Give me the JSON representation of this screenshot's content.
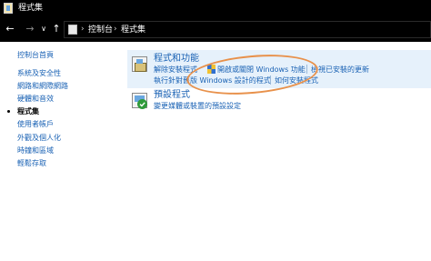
{
  "window": {
    "title": "程式集"
  },
  "nav": {
    "back": "←",
    "forward": "→",
    "recent": "∨",
    "up": "↑",
    "breadcrumb": [
      "控制台",
      "程式集"
    ],
    "separator": "›"
  },
  "sidebar": {
    "items": [
      {
        "label": "控制台首頁",
        "current": false
      },
      {
        "label": "系統及安全性",
        "current": false
      },
      {
        "label": "網路和網際網路",
        "current": false
      },
      {
        "label": "硬體和音效",
        "current": false
      },
      {
        "label": "程式集",
        "current": true
      },
      {
        "label": "使用者帳戶",
        "current": false
      },
      {
        "label": "外觀及個人化",
        "current": false
      },
      {
        "label": "時鐘和區域",
        "current": false
      },
      {
        "label": "輕鬆存取",
        "current": false
      }
    ]
  },
  "categories": [
    {
      "title": "程式和功能",
      "tasks": [
        "解除安裝程式",
        "開啟或關閉 Windows 功能",
        "檢視已安裝的更新",
        "執行針對舊版 Windows 設計的程式",
        "如何安裝程式"
      ]
    },
    {
      "title": "預設程式",
      "tasks": [
        "變更媒體或裝置的預設設定"
      ]
    }
  ],
  "colors": {
    "link": "#1a62b4",
    "panel_highlight": "#e6f1fb",
    "annotation": "#e8914b"
  }
}
